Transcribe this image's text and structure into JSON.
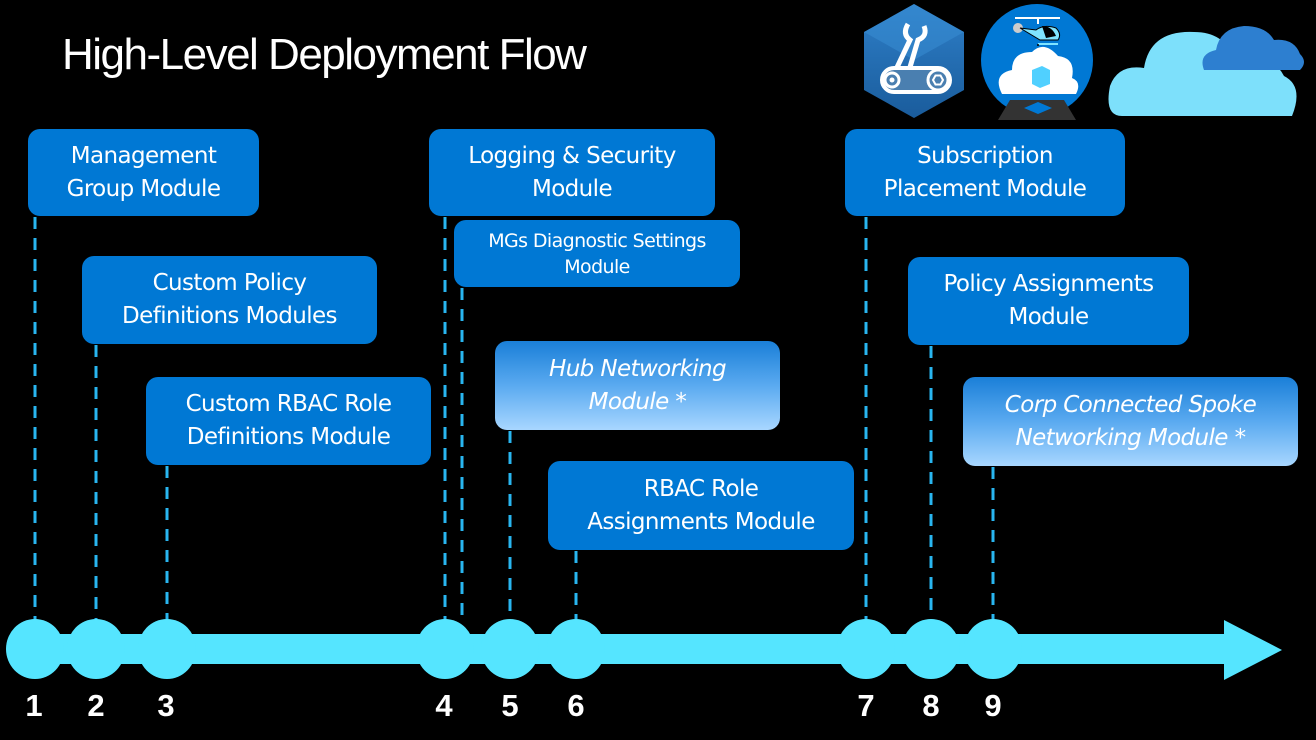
{
  "title": "High-Level Deployment Flow",
  "colors": {
    "background": "#000000",
    "module_box": "#0078d4",
    "optional_box_gradient": [
      "#1a7fd8",
      "#a8d6ff"
    ],
    "timeline": "#55e5ff",
    "dashed_connector": "#29b6f0",
    "text": "#ffffff"
  },
  "icons": [
    "automation-hexagon-icon",
    "helicopter-deploy-cloud-icon",
    "cloud-icon"
  ],
  "steps": [
    {
      "number": "1",
      "label_lines": [
        "Management",
        "Group Module"
      ],
      "optional": false
    },
    {
      "number": "2",
      "label_lines": [
        "Custom Policy",
        "Definitions Modules"
      ],
      "optional": false
    },
    {
      "number": "3",
      "label_lines": [
        "Custom RBAC Role",
        "Definitions Module"
      ],
      "optional": false
    },
    {
      "number": "4",
      "label_lines": [
        "Logging & Security",
        "Module"
      ],
      "optional": false
    },
    {
      "number": "",
      "label_lines": [
        "MGs Diagnostic Settings",
        "Module"
      ],
      "optional": false
    },
    {
      "number": "5",
      "label_lines": [
        "Hub Networking",
        "Module *"
      ],
      "optional": true
    },
    {
      "number": "6",
      "label_lines": [
        "RBAC Role",
        "Assignments Module"
      ],
      "optional": false
    },
    {
      "number": "7",
      "label_lines": [
        "Subscription",
        "Placement Module"
      ],
      "optional": false
    },
    {
      "number": "8",
      "label_lines": [
        "Policy Assignments",
        "Module"
      ],
      "optional": false
    },
    {
      "number": "9",
      "label_lines": [
        "Corp Connected Spoke",
        "Networking Module *"
      ],
      "optional": true
    }
  ]
}
